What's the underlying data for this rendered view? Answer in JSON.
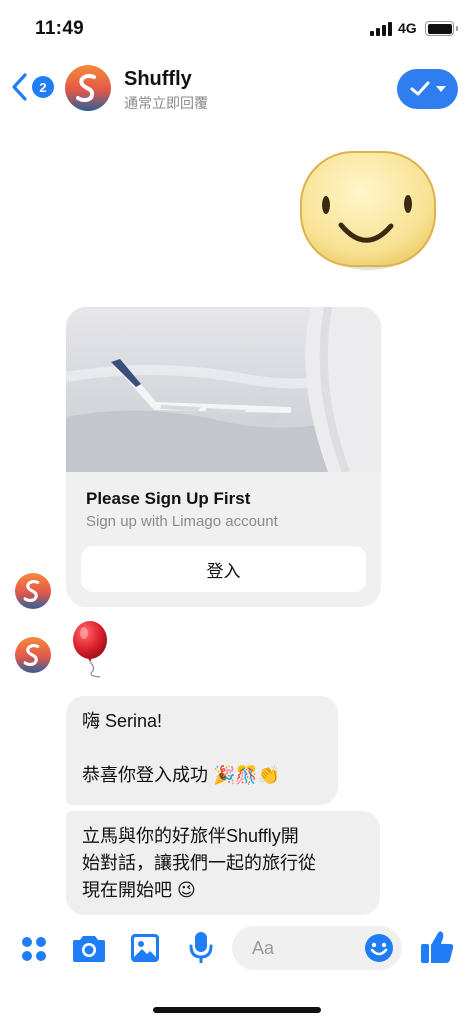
{
  "status_bar": {
    "time": "11:49",
    "network": "4G"
  },
  "header": {
    "back_badge": "2",
    "contact_name": "Shuffly",
    "subtitle": "通常立即回覆"
  },
  "card": {
    "title": "Please Sign Up First",
    "subtitle": "Sign up with Limago account",
    "button_label": "登入"
  },
  "messages": {
    "bubble1_line1": "嗨 Serina!",
    "bubble1_line2": "恭喜你登入成功 🎉🎊👏",
    "bubble2_line1": "立馬與你的好旅伴Shuffly開",
    "bubble2_line2": "始對話，讓我們一起的旅行從",
    "bubble2_line3": "現在開始吧 😉"
  },
  "composer": {
    "placeholder": "Aa"
  },
  "icons": [
    "apps-icon",
    "camera-icon",
    "image-icon",
    "microphone-icon",
    "emoji-icon",
    "thumbs-up-icon",
    "checkmark-icon",
    "back-chevron-icon"
  ],
  "colors": {
    "accent": "#1f7ef5",
    "bubble": "#efefef",
    "brand_gradient_top": "#f07a3a",
    "brand_gradient_bottom": "#2f5f96"
  }
}
